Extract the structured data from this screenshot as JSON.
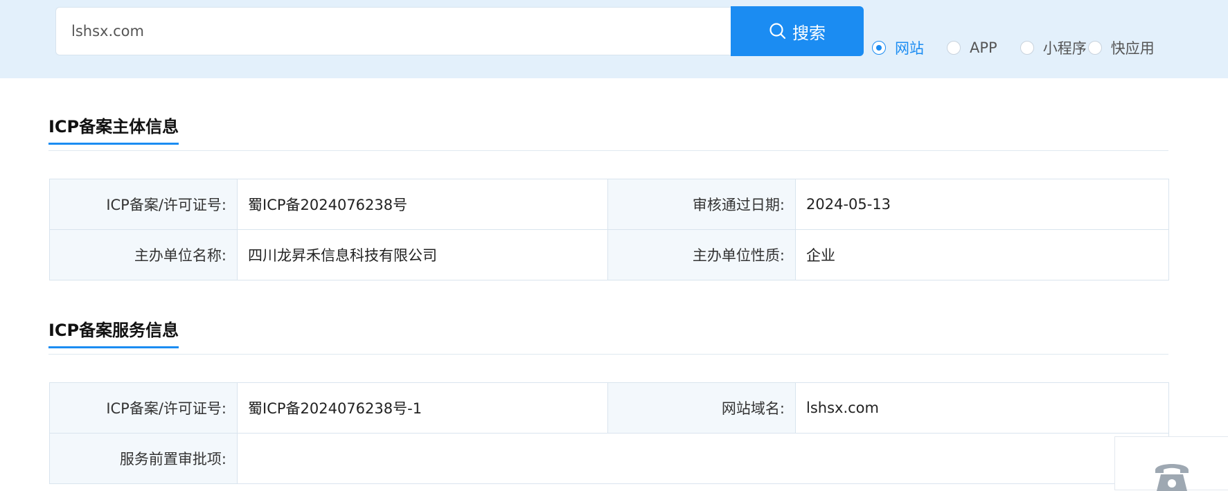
{
  "search": {
    "value": "lshsx.com",
    "button_label": "搜索",
    "types": [
      {
        "label": "网站",
        "checked": true
      },
      {
        "label": "APP",
        "checked": false
      },
      {
        "label": "小程序",
        "checked": false
      },
      {
        "label": "快应用",
        "checked": false
      }
    ]
  },
  "main_info": {
    "title": "ICP备案主体信息",
    "rows": [
      {
        "k1": "ICP备案/许可证号:",
        "v1": "蜀ICP备2024076238号",
        "k2": "审核通过日期:",
        "v2": "2024-05-13"
      },
      {
        "k1": "主办单位名称:",
        "v1": "四川龙昇禾信息科技有限公司",
        "k2": "主办单位性质:",
        "v2": "企业"
      }
    ]
  },
  "service_info": {
    "title": "ICP备案服务信息",
    "rows": [
      {
        "k1": "ICP备案/许可证号:",
        "v1": "蜀ICP备2024076238号-1",
        "k2": "网站域名:",
        "v2": "lshsx.com"
      },
      {
        "k1": "服务前置审批项:",
        "v1": ""
      }
    ]
  },
  "colors": {
    "accent": "#1b8cf2",
    "topbar_bg": "#e3f0fb",
    "key_cell_bg": "#f3f8fc"
  },
  "icons": {
    "search": "search-icon",
    "phone": "phone-icon"
  }
}
